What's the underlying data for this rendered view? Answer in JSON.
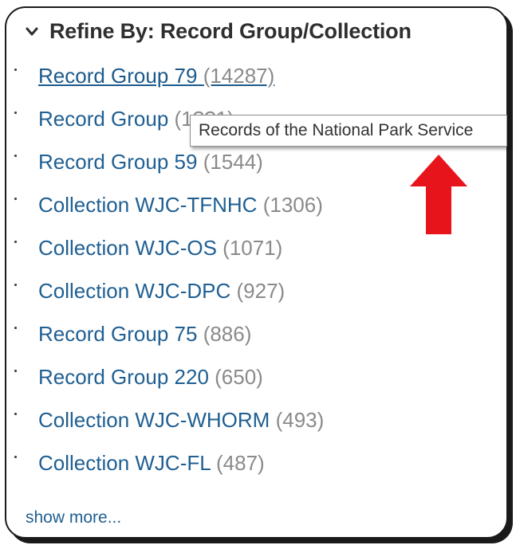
{
  "facet": {
    "header": "Refine By: Record Group/Collection",
    "items": [
      {
        "label": "Record Group 79",
        "count": "(14287)",
        "hovered": true
      },
      {
        "label": "Record Group 59",
        "count": "(1544)"
      },
      {
        "label": "Collection WJC-TFNHC",
        "count": "(1306)"
      },
      {
        "label": "Collection WJC-OS",
        "count": "(1071)"
      },
      {
        "label": "Collection WJC-DPC",
        "count": "(927)"
      },
      {
        "label": "Record Group 75",
        "count": "(886)"
      },
      {
        "label": "Record Group 220",
        "count": "(650)"
      },
      {
        "label": "Collection WJC-WHORM",
        "count": "(493)"
      },
      {
        "label": "Collection WJC-FL",
        "count": "(487)"
      }
    ],
    "obscured_item": {
      "label_visible": "Record Group ",
      "count_visible": "(1??1)"
    },
    "show_more": "show more..."
  },
  "tooltip": {
    "text": "Records of the National Park Service"
  },
  "annotation": {
    "arrow_color": "#e8141c",
    "arrow_icon": "up-arrow-icon"
  },
  "colors": {
    "link": "#1f5f92",
    "count": "#8a8a8a",
    "header": "#2f2f2f"
  }
}
